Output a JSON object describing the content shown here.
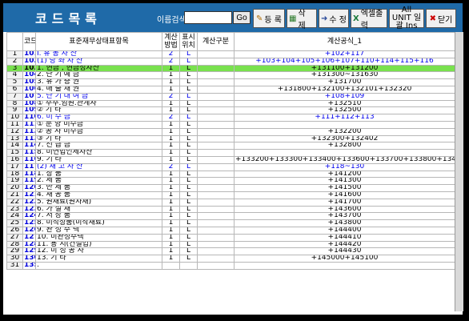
{
  "window": {
    "title": "코드목록"
  },
  "search": {
    "label": "이름검색",
    "placeholder": "",
    "go": "Go"
  },
  "toolbar": {
    "register": "등 록",
    "delete": "삭 제",
    "edit": "수 정",
    "excel": "엑셀출력",
    "allunit": "All UNIT 일괄 Ins",
    "close": "닫기"
  },
  "columns": [
    "코드",
    "표준재무상태표항목",
    "계산 방법",
    "표시 위치",
    "계산구분",
    "계산공식_1"
  ],
  "rows": [
    {
      "n": "1",
      "code": "101",
      "name": "I. 유  동  자  산",
      "calc": "2",
      "pos": "L",
      "formula": "+102+117",
      "style": "blue"
    },
    {
      "n": "2",
      "code": "102",
      "name": "(1) 당  좌  자  산",
      "calc": "2",
      "pos": "L",
      "formula": "+103+104+105+106+107+110+114+115+116",
      "style": "blue"
    },
    {
      "n": "3",
      "code": "103",
      "name": "1. 현금 , 현금성자산",
      "calc": "1",
      "pos": "L",
      "formula": "+131100+131200",
      "style": "sel"
    },
    {
      "n": "4",
      "code": "104",
      "name": "2. 단  기  예  금",
      "calc": "1",
      "pos": "L",
      "formula": "+131300~131630",
      "style": ""
    },
    {
      "n": "5",
      "code": "105",
      "name": "3. 유  가  증  권",
      "calc": "1",
      "pos": "L",
      "formula": "+131700",
      "style": ""
    },
    {
      "n": "6",
      "code": "106",
      "name": "4. 매  출  채  권",
      "calc": "1",
      "pos": "L",
      "formula": "+131800+132100+132101+132320",
      "style": ""
    },
    {
      "n": "7",
      "code": "107",
      "name": "5. 단  기  대 여 금",
      "calc": "2",
      "pos": "L",
      "formula": "+108+109",
      "style": "blue"
    },
    {
      "n": "8",
      "code": "108",
      "name": "① 주주.임원.관계사",
      "calc": "1",
      "pos": "L",
      "formula": "+132510",
      "style": ""
    },
    {
      "n": "9",
      "code": "109",
      "name": "② 기        타",
      "calc": "1",
      "pos": "L",
      "formula": "+132500",
      "style": ""
    },
    {
      "n": "10",
      "code": "110",
      "name": "6. 미      수      금",
      "calc": "2",
      "pos": "L",
      "formula": "+111+112+113",
      "style": "blue"
    },
    {
      "n": "11",
      "code": "111",
      "name": "① 분 양  미수금",
      "calc": "1",
      "pos": "L",
      "formula": "",
      "style": ""
    },
    {
      "n": "12",
      "code": "112",
      "name": "② 공 사  미수금",
      "calc": "1",
      "pos": "L",
      "formula": "+132200",
      "style": ""
    },
    {
      "n": "13",
      "code": "113",
      "name": "③ 기        타",
      "calc": "1",
      "pos": "L",
      "formula": "+132300+132402",
      "style": ""
    },
    {
      "n": "14",
      "code": "114",
      "name": "7. 선      급      금",
      "calc": "1",
      "pos": "L",
      "formula": "+132800",
      "style": ""
    },
    {
      "n": "15",
      "code": "115",
      "name": "8. 미연법인세자산",
      "calc": "1",
      "pos": "L",
      "formula": "",
      "style": ""
    },
    {
      "n": "16",
      "code": "116",
      "name": "9. 기          타",
      "calc": "1",
      "pos": "L",
      "formula": "+133200+133300+133400+133600+133700+133800+134000+134001",
      "style": ""
    },
    {
      "n": "17",
      "code": "117",
      "name": "(2) 재  고  자  산",
      "calc": "2",
      "pos": "L",
      "formula": "+118~130",
      "style": "blue"
    },
    {
      "n": "18",
      "code": "118",
      "name": "1. 상          품",
      "calc": "1",
      "pos": "L",
      "formula": "+141200",
      "style": ""
    },
    {
      "n": "19",
      "code": "119",
      "name": "2. 제          품",
      "calc": "1",
      "pos": "L",
      "formula": "+141300",
      "style": ""
    },
    {
      "n": "20",
      "code": "120",
      "name": "3. 반    제    품",
      "calc": "1",
      "pos": "L",
      "formula": "+141500",
      "style": ""
    },
    {
      "n": "21",
      "code": "121",
      "name": "4. 재    공    품",
      "calc": "1",
      "pos": "L",
      "formula": "+141600",
      "style": ""
    },
    {
      "n": "22",
      "code": "122",
      "name": "5. 원재료(원자재)",
      "calc": "1",
      "pos": "L",
      "formula": "+141700",
      "style": ""
    },
    {
      "n": "23",
      "code": "123",
      "name": "6. 가    설    재",
      "calc": "1",
      "pos": "L",
      "formula": "+143600",
      "style": ""
    },
    {
      "n": "24",
      "code": "124",
      "name": "7. 저    장    품",
      "calc": "1",
      "pos": "L",
      "formula": "+143700",
      "style": ""
    },
    {
      "n": "25",
      "code": "125",
      "name": "8. 미착상품(미착재료)",
      "calc": "1",
      "pos": "L",
      "formula": "+143800",
      "style": ""
    },
    {
      "n": "26",
      "code": "126",
      "name": "9. 완  성  주  택",
      "calc": "1",
      "pos": "L",
      "formula": "+144400",
      "style": ""
    },
    {
      "n": "27",
      "code": "127",
      "name": "10. 미완성주택",
      "calc": "1",
      "pos": "L",
      "formula": "+144410",
      "style": ""
    },
    {
      "n": "28",
      "code": "128",
      "name": "11. 용  지(건설업)",
      "calc": "1",
      "pos": "L",
      "formula": "+144420",
      "style": ""
    },
    {
      "n": "29",
      "code": "129",
      "name": "12. 미  성  공  사",
      "calc": "1",
      "pos": "L",
      "formula": "+144430",
      "style": ""
    },
    {
      "n": "30",
      "code": "130",
      "name": "13. 기        타",
      "calc": "1",
      "pos": "L",
      "formula": "+145000+145100",
      "style": ""
    },
    {
      "n": "31",
      "code": "135",
      "name": ".",
      "calc": "",
      "pos": "",
      "formula": "",
      "style": "plain"
    }
  ]
}
